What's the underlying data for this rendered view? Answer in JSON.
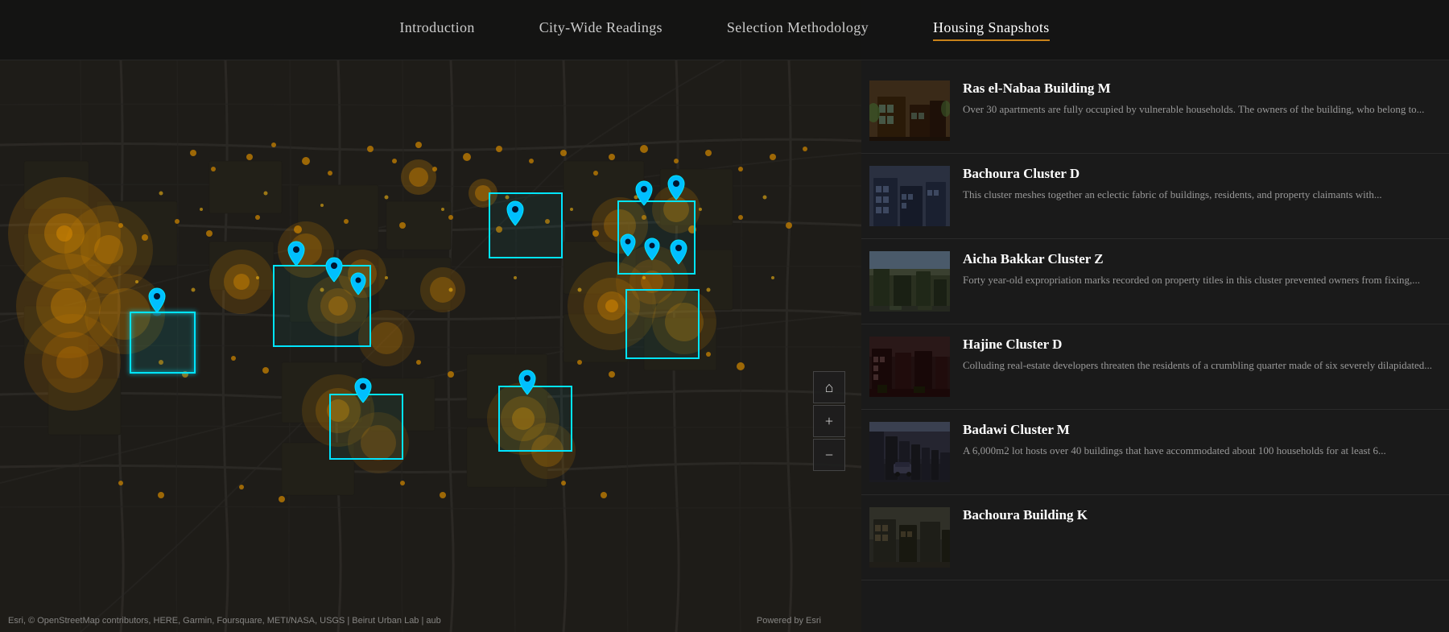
{
  "nav": {
    "items": [
      {
        "id": "introduction",
        "label": "Introduction",
        "active": false
      },
      {
        "id": "city-wide",
        "label": "City-Wide Readings",
        "active": false
      },
      {
        "id": "selection",
        "label": "Selection Methodology",
        "active": false
      },
      {
        "id": "housing",
        "label": "Housing Snapshots",
        "active": true
      }
    ]
  },
  "map": {
    "attribution": "Esri, © OpenStreetMap contributors, HERE, Garmin, Foursquare, METI/NASA, USGS | Beirut Urban Lab | aub",
    "powered_by": "Powered by Esri",
    "controls": {
      "home": "⌂",
      "zoom_in": "+",
      "zoom_out": "−"
    }
  },
  "snapshots": [
    {
      "id": "ras-el-nabaa",
      "title": "Ras el-Nabaa Building M",
      "description": "Over 30 apartments are fully occupied by vulnerable households. The owners of the building, who belong to...",
      "thumb_class": "thumb-1"
    },
    {
      "id": "bachoura-d",
      "title": "Bachoura Cluster D",
      "description": "This cluster meshes together an eclectic fabric of buildings, residents, and property claimants with...",
      "thumb_class": "thumb-2"
    },
    {
      "id": "aicha-bakkar",
      "title": "Aicha Bakkar Cluster Z",
      "description": "Forty year-old expropriation marks recorded on property titles in this cluster prevented owners from fixing,...",
      "thumb_class": "thumb-3"
    },
    {
      "id": "hajine-d",
      "title": "Hajine Cluster D",
      "description": "Colluding real-estate developers threaten the residents of a crumbling quarter made of six severely dilapidated...",
      "thumb_class": "thumb-4"
    },
    {
      "id": "badawi-m",
      "title": "Badawi Cluster M",
      "description": "A 6,000m2 lot hosts over 40 buildings that have accommodated about 100 households for at least 6...",
      "thumb_class": "thumb-5"
    },
    {
      "id": "bachoura-k",
      "title": "Bachoura Building K",
      "description": "",
      "thumb_class": "thumb-6"
    }
  ]
}
